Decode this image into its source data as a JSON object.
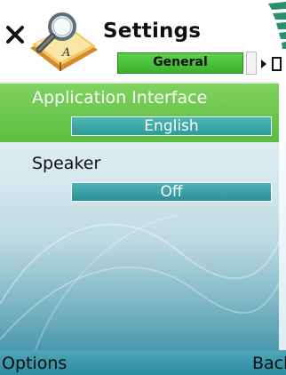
{
  "header": {
    "title": "Settings",
    "tab_label": "General",
    "close_icon": "close-icon",
    "app_icon": "settings-app-icon"
  },
  "list": {
    "items": [
      {
        "label": "Application Interface",
        "value": "English",
        "selected": true
      },
      {
        "label": "Speaker",
        "value": "Off",
        "selected": false
      }
    ]
  },
  "softkeys": {
    "left": "Options",
    "right": "Back"
  },
  "colors": {
    "selection_green": "#5dbd40",
    "value_teal": "#2f9a9a",
    "softkey_bar": "#2b8ca1",
    "tab_green": "#3bb12e"
  }
}
